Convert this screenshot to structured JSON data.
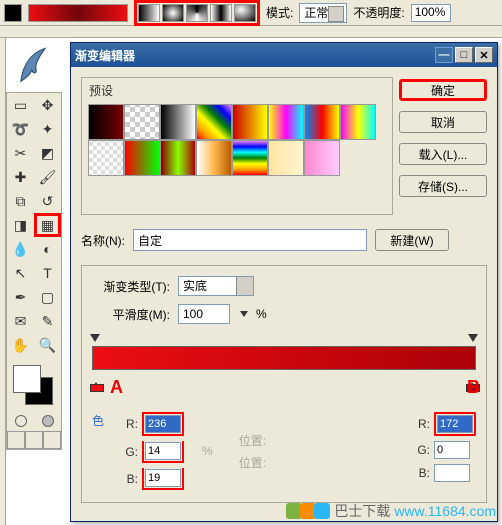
{
  "topbar": {
    "mode_label": "模式:",
    "mode_value": "正常",
    "opacity_label": "不透明度:",
    "opacity_value": "100%"
  },
  "dialog": {
    "title": "渐变编辑器",
    "presets_label": "预设",
    "ok": "确定",
    "cancel": "取消",
    "load": "载入(L)...",
    "save": "存储(S)...",
    "new_btn": "新建(W)",
    "name_label": "名称(N):",
    "name_value": "自定",
    "type_label": "渐变类型(T):",
    "type_value": "实底",
    "smooth_label": "平滑度(M):",
    "smooth_value": "100",
    "pct": "%",
    "marker_a": "A",
    "marker_b": "B",
    "color_heading": "色",
    "R_label": "R:",
    "G_label": "G:",
    "B_label": "B:",
    "left": {
      "R": "236",
      "G": "14",
      "B": "19"
    },
    "right": {
      "R": "172",
      "G": "0",
      "B": ""
    },
    "position_label": "位置:"
  },
  "watermark": {
    "brand": "巴士下载",
    "url": "www.11684.com"
  }
}
